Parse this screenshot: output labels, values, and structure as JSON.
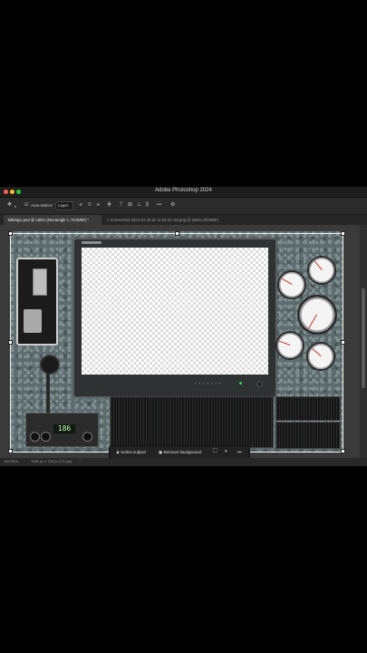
{
  "window": {
    "title": "Adobe Photoshop 2024"
  },
  "traffic_colors": [
    "#ff5f57",
    "#febc2e",
    "#28c840"
  ],
  "options_bar": {
    "auto_select_label": "Auto-Select:",
    "auto_select_value": "Layer",
    "more_label": "•••"
  },
  "tabs": [
    {
      "label": "TalkingU.psd @ 185% (Rectangle 1, RGB/8#) *",
      "active": true
    },
    {
      "label": "Screenshot 2024-07-18 at 12.15.42 AM.png @ 250% (RGB/8*)",
      "active": false
    }
  ],
  "artwork": {
    "cb_radio_display": "186",
    "monitor_indicator": "▪ ▪ ▪ ▪ ▪ ▪ ▪"
  },
  "context_bar": {
    "select_subject": "Select subject",
    "remove_background": "Remove background",
    "more": "•••"
  },
  "status_bar": {
    "zoom": "184.59%",
    "doc_size": "1080 px x 720 px (72 ppi)"
  }
}
